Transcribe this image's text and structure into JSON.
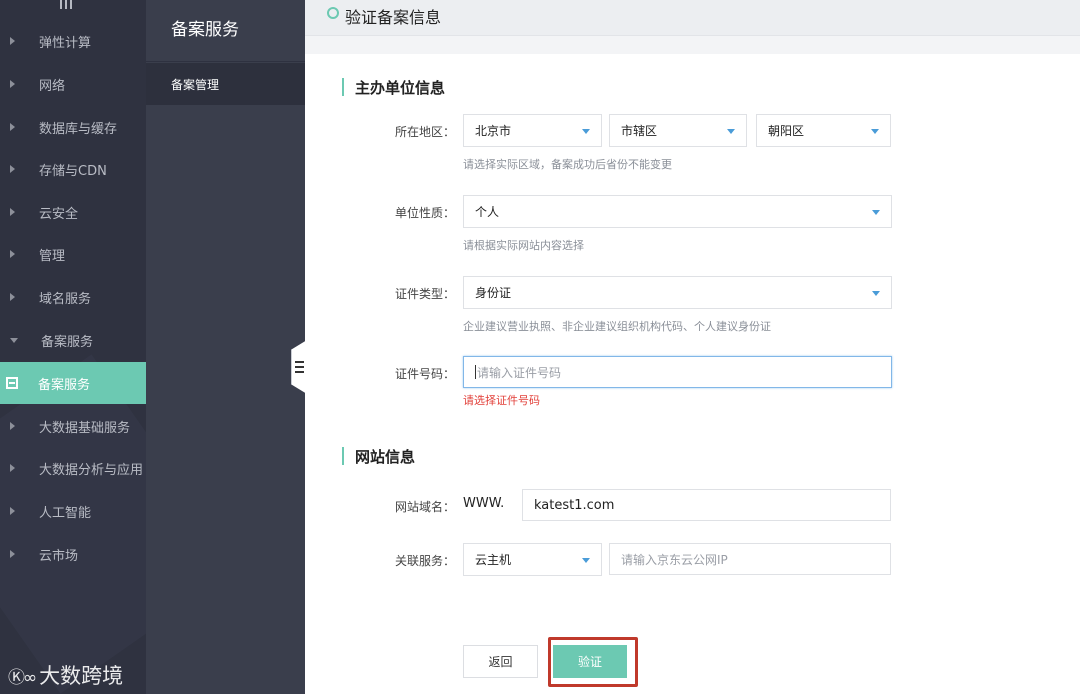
{
  "sidebar": {
    "items": [
      {
        "label": "弹性计算"
      },
      {
        "label": "网络"
      },
      {
        "label": "数据库与缓存"
      },
      {
        "label": "存储与CDN"
      },
      {
        "label": "云安全"
      },
      {
        "label": "管理"
      },
      {
        "label": "域名服务"
      },
      {
        "label": "备案服务"
      },
      {
        "label": "备案服务"
      },
      {
        "label": "大数据基础服务"
      },
      {
        "label": "大数据分析与应用"
      },
      {
        "label": "人工智能"
      },
      {
        "label": "云市场"
      }
    ],
    "brand": "大数跨境"
  },
  "subnav": {
    "title": "备案服务",
    "item": "备案管理"
  },
  "page": {
    "title": "验证备案信息"
  },
  "sponsor": {
    "section_title": "主办单位信息",
    "region_label": "所在地区：",
    "province": "北京市",
    "city": "市辖区",
    "district": "朝阳区",
    "region_hint": "请选择实际区域，备案成功后省份不能变更",
    "nature_label": "单位性质：",
    "nature_value": "个人",
    "nature_hint": "请根据实际网站内容选择",
    "cert_type_label": "证件类型：",
    "cert_type_value": "身份证",
    "cert_type_hint": "企业建议营业执照、非企业建议组织机构代码、个人建议身份证",
    "cert_no_label": "证件号码：",
    "cert_no_placeholder": "请输入证件号码",
    "cert_no_error": "请选择证件号码"
  },
  "website": {
    "section_title": "网站信息",
    "domain_label": "网站域名：",
    "domain_prefix": "WWW.",
    "domain_value": "katest1.com",
    "service_label": "关联服务：",
    "service_value": "云主机",
    "ip_placeholder": "请输入京东云公网IP"
  },
  "actions": {
    "back_label": "返回",
    "verify_label": "验证"
  },
  "colors": {
    "accent": "#6cc9b2",
    "sidebar_bg": "#2f3240",
    "error": "#e2403a",
    "highlight": "#c0392b"
  }
}
